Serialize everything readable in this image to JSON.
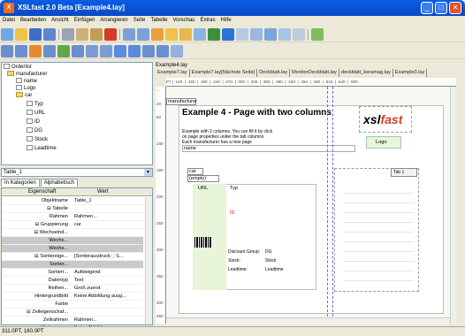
{
  "window": {
    "title": "XSLfast 2.0 Beta [Example4.lay]",
    "min": "_",
    "max": "□",
    "close": "✕"
  },
  "menu": [
    "Datei",
    "Bearbeiten",
    "Ansicht",
    "Einfügen",
    "Arrangieren",
    "Seite",
    "Tabelle",
    "Vorschau",
    "Extras",
    "Hilfe"
  ],
  "tree": {
    "root": "Orderlist",
    "manufacturer": "manufacturer",
    "name": "name",
    "logo": "Logo",
    "car": "car",
    "typ": "Typ",
    "url": "URL",
    "id": "ID",
    "dg": "DG",
    "stock": "Stock",
    "leadtime": "Leadtime"
  },
  "table_combo": "Table_1",
  "prop_tabs": [
    "In Kategorien",
    "Alphabetisch"
  ],
  "props": {
    "header_key": "Eigenschaft",
    "header_val": "Wert",
    "rows": [
      {
        "k": "Objektname",
        "v": "Table_1"
      },
      {
        "k": "⊟ Tabelle",
        "v": ""
      },
      {
        "k": "Rahmen",
        "v": "Rahmen..."
      },
      {
        "k": "⊟ Gruppierung",
        "v": "car"
      },
      {
        "k": "⊟ Wechselnd...",
        "v": ""
      },
      {
        "k": "Wechs...",
        "v": ""
      },
      {
        "k": "Wechs...",
        "v": ""
      },
      {
        "k": "⊟ Sortiereige...",
        "v": "[Sortierausdruck: ; S..."
      },
      {
        "k": "Sortier...",
        "v": ""
      },
      {
        "k": "Sortierr...",
        "v": "Aufsteigend"
      },
      {
        "k": "Datentyp",
        "v": "Text"
      },
      {
        "k": "Reihen...",
        "v": "Groß zuerst"
      },
      {
        "k": "Hintergrundbild",
        "v": "Keine Abbildung ausg..."
      },
      {
        "k": "Farbe",
        "v": ""
      },
      {
        "k": "⊟ Zelleigenschaf...",
        "v": ""
      },
      {
        "k": "Zellrahmen",
        "v": "Rahmen..."
      },
      {
        "k": "Hintergrun...",
        "v": "Keine Abbildung ausg..."
      }
    ]
  },
  "doc": {
    "file": "Example4.lay",
    "tabs": [
      "Example7.lay",
      "Example7.lay[Nächste Seite]",
      "Deckblatt.lay",
      "MonitorDeckblatt.lay",
      "deckblatt_keramag.lay",
      "Example3.lay"
    ],
    "ruler": "P7  | ·120· | ·150· | ·180· | ·240· | ·270· | ·300· | ·330· | ·360· | ·390· | ·420· | ·450· | ·480· | ·510· | ·540· | ·600·",
    "vruler": [
      "−",
      "20",
      "50",
      "",
      "100",
      "",
      "190",
      "",
      "200",
      "",
      "250",
      "",
      "300",
      "",
      "350",
      "",
      "400",
      "450"
    ],
    "manufacturer_tag": "manufacturer",
    "heading": "Example 4 - Page with two columns",
    "desc1": "Example with 2 columns. You can fill it by click",
    "desc2": "on page properties under the tab columns",
    "desc3": "Each manufacturer has a new page",
    "name_field": "name",
    "logo_text": "xsl",
    "logo_text2": "fast",
    "logo_label": "Logo",
    "car_tag": "car",
    "empty_tag": "(empty)",
    "url_label": "URL",
    "typ_label": "Typ",
    "id_label": "ID",
    "discount": "Discount Group:",
    "dg_label": "DG",
    "stock_key": "Stock:",
    "stock_val": "Stock",
    "lead_key": "Leadtime:",
    "lead_val": "Leadtime",
    "tab_label": "Tab",
    "tab_num": "1"
  },
  "status": "311.0PT, 160.0PT",
  "colors": {
    "title": "#0b4fd4",
    "accent": "#f26b1d",
    "field_green": "#e8f5d8"
  }
}
